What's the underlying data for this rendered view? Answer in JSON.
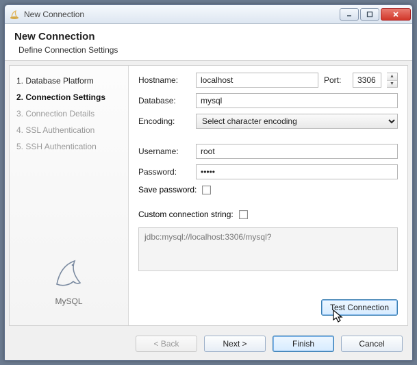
{
  "window": {
    "title": "New Connection"
  },
  "header": {
    "title": "New Connection",
    "subtitle": "Define Connection Settings"
  },
  "sidebar": {
    "steps": [
      {
        "label": "1. Database Platform",
        "state": "done"
      },
      {
        "label": "2. Connection Settings",
        "state": "active"
      },
      {
        "label": "3. Connection Details",
        "state": "pending"
      },
      {
        "label": "4. SSL Authentication",
        "state": "pending"
      },
      {
        "label": "5. SSH Authentication",
        "state": "pending"
      }
    ],
    "db_name": "MySQL"
  },
  "form": {
    "hostname_label": "Hostname:",
    "hostname_value": "localhost",
    "port_label": "Port:",
    "port_value": "3306",
    "database_label": "Database:",
    "database_value": "mysql",
    "encoding_label": "Encoding:",
    "encoding_selected": "Select character encoding",
    "username_label": "Username:",
    "username_value": "root",
    "password_label": "Password:",
    "password_value": "•••••",
    "save_password_label": "Save password:",
    "save_password_checked": false,
    "custom_label": "Custom connection string:",
    "custom_checked": false,
    "custom_value": "jdbc:mysql://localhost:3306/mysql?",
    "test_button": "Test Connection"
  },
  "footer": {
    "back": "< Back",
    "next": "Next >",
    "finish": "Finish",
    "cancel": "Cancel"
  }
}
